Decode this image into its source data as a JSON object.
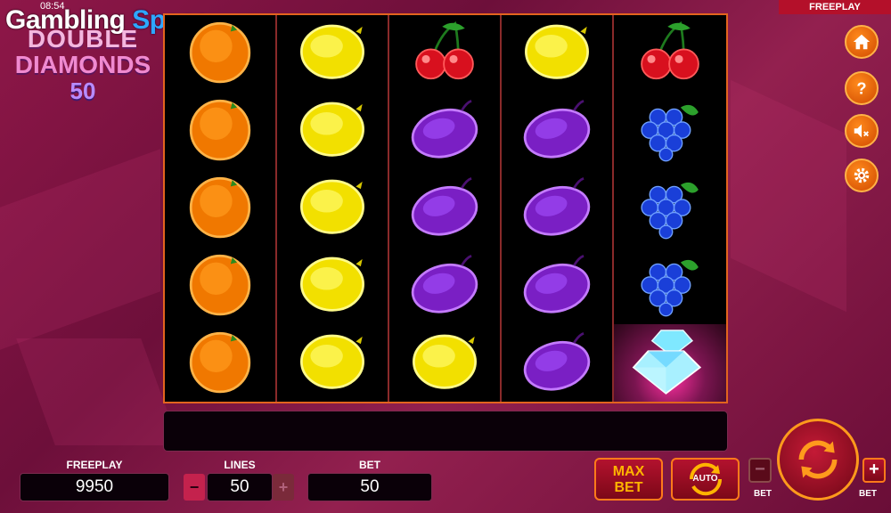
{
  "status": {
    "clock": "08:54",
    "mode_badge": "FREEPLAY"
  },
  "brand": {
    "part1": "Gambling",
    "part2": "Space"
  },
  "game_logo": {
    "line1": "DOUBLE",
    "line2": "DIAMONDS",
    "line3": "50"
  },
  "reels": [
    [
      "orange",
      "orange",
      "orange",
      "orange",
      "orange"
    ],
    [
      "lemon",
      "lemon",
      "lemon",
      "lemon",
      "lemon"
    ],
    [
      "cherry",
      "plum",
      "plum",
      "plum",
      "lemon"
    ],
    [
      "lemon",
      "plum",
      "plum",
      "plum",
      "plum"
    ],
    [
      "cherry",
      "grapes",
      "grapes",
      "grapes",
      "diamond"
    ]
  ],
  "side_buttons": [
    "home-icon",
    "help-icon",
    "sound-off-icon",
    "settings-icon"
  ],
  "panel": {
    "balance_label": "FREEPLAY",
    "balance_value": "9950",
    "lines_label": "LINES",
    "lines_value": "50",
    "lines_minus": "−",
    "lines_plus": "+",
    "bet_label": "BET",
    "bet_value": "50"
  },
  "controls": {
    "max_bet_line1": "MAX",
    "max_bet_line2": "BET",
    "auto_label": "AUTO",
    "bet_minus_symbol": "−",
    "bet_minus_label": "BET",
    "bet_plus_symbol": "+",
    "bet_plus_label": "BET"
  },
  "colors": {
    "accent": "#ff8a1c",
    "reel_border": "#e3641e",
    "background": "#8e1748"
  }
}
